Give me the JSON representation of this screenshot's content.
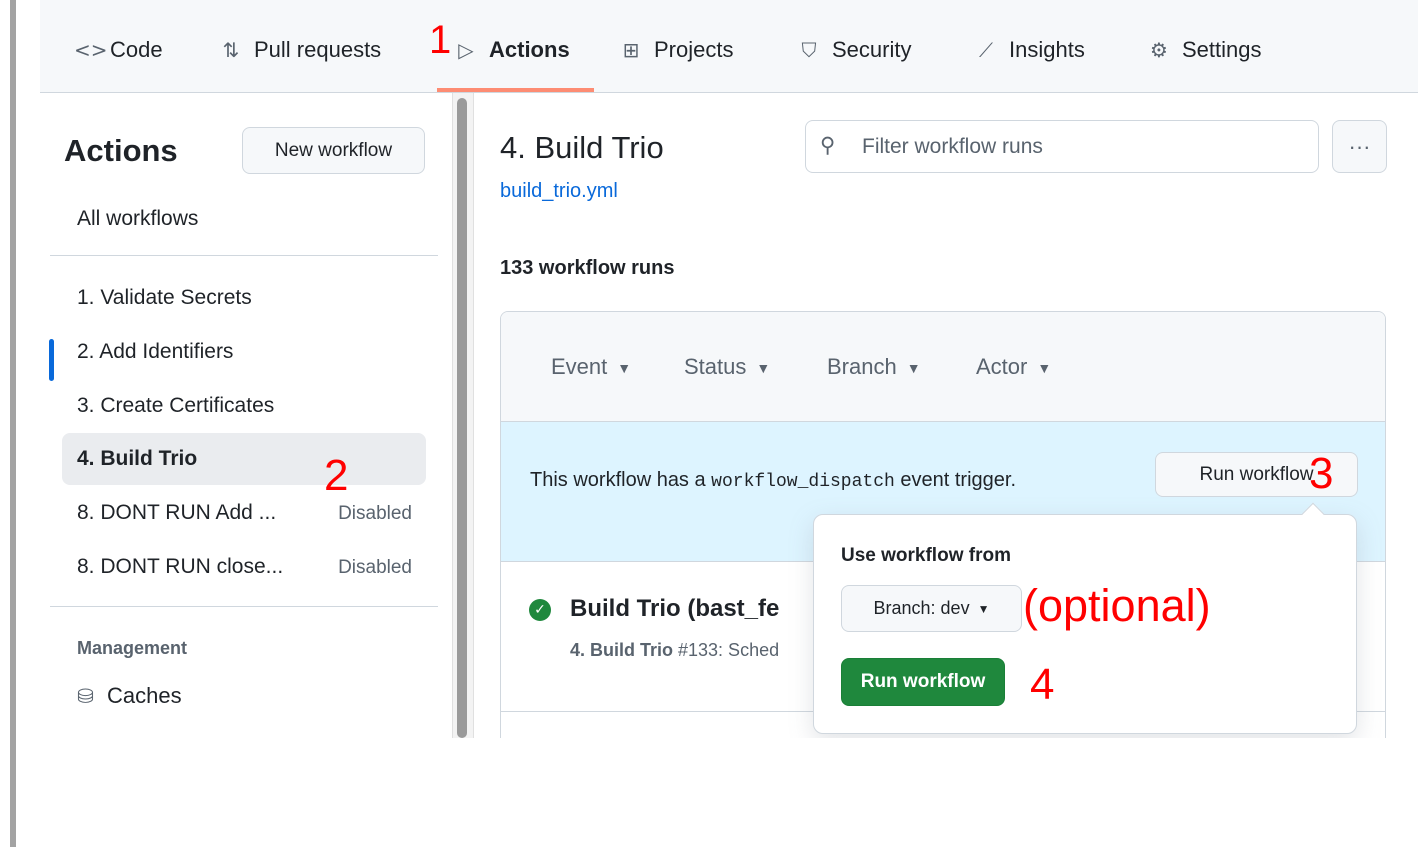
{
  "repo_nav": {
    "tabs": [
      {
        "label": "Code",
        "icon": "code-icon",
        "glyph": "<>"
      },
      {
        "label": "Pull requests",
        "icon": "git-pull-request-icon",
        "glyph": "⇅"
      },
      {
        "label": "Actions",
        "icon": "play-circle-icon",
        "glyph": "▷",
        "active": true
      },
      {
        "label": "Projects",
        "icon": "table-icon",
        "glyph": "⊞"
      },
      {
        "label": "Security",
        "icon": "shield-icon",
        "glyph": "⛉"
      },
      {
        "label": "Insights",
        "icon": "graph-icon",
        "glyph": "⟋"
      },
      {
        "label": "Settings",
        "icon": "gear-icon",
        "glyph": "⚙"
      }
    ],
    "accent_color": "#fd8c73"
  },
  "sidebar": {
    "title": "Actions",
    "new_workflow_label": "New workflow",
    "all_workflows_label": "All workflows",
    "workflows": [
      {
        "label": "1. Validate Secrets",
        "badge": ""
      },
      {
        "label": "2. Add Identifiers",
        "badge": ""
      },
      {
        "label": "3. Create Certificates",
        "badge": ""
      },
      {
        "label": "4. Build Trio",
        "badge": "",
        "selected": true
      },
      {
        "label": "8. DONT RUN Add ...",
        "badge": "Disabled"
      },
      {
        "label": "8. DONT RUN close...",
        "badge": "Disabled"
      }
    ],
    "management_heading": "Management",
    "caches_label": "Caches",
    "caches_icon": "database-icon"
  },
  "main": {
    "workflow_title": "4. Build Trio",
    "workflow_file": "build_trio.yml",
    "filter_placeholder": "Filter workflow runs",
    "more_glyph": "···",
    "runs_count": "133 workflow runs",
    "filters": [
      "Event",
      "Status",
      "Branch",
      "Actor"
    ],
    "dispatch_text_before": "This workflow has a ",
    "dispatch_code": "workflow_dispatch",
    "dispatch_text_after": " event trigger.",
    "run_workflow_button": "Run workflow",
    "run": {
      "title": "Build Trio (bast_fe",
      "workflow_name": "4. Build Trio",
      "subtitle_rest": " #133: Sched"
    },
    "status_color": "#1f883d",
    "link_color": "#0969da"
  },
  "popover": {
    "title": "Use workflow from",
    "branch_label": "Branch: dev",
    "run_button": "Run workflow",
    "primary_color": "#1f883d"
  },
  "annotations": {
    "step1": "1",
    "step2": "2",
    "step3": "3",
    "step4": "4",
    "optional": "(optional)",
    "color": "#ff0000"
  }
}
